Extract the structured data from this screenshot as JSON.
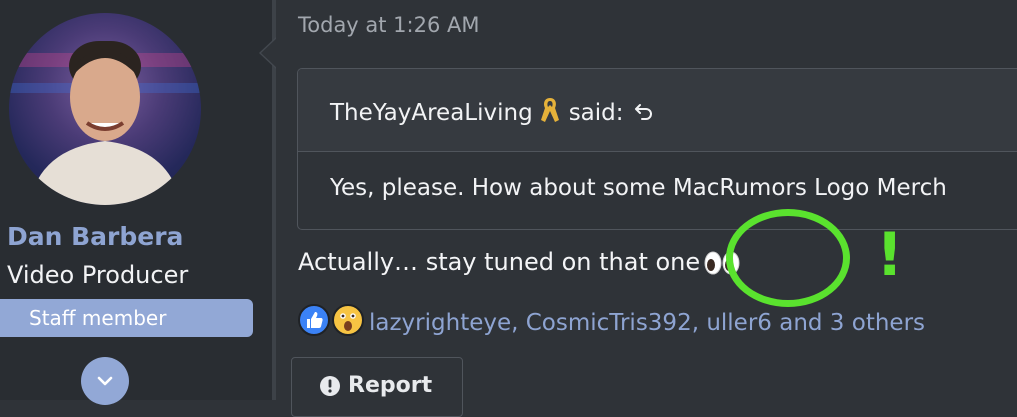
{
  "author": {
    "name": "Dan Barbera",
    "title": "Video Producer",
    "badge": "Staff member"
  },
  "post": {
    "timestamp": "Today at 1:26 AM",
    "quote": {
      "author": "TheYayAreaLiving",
      "said": "said:",
      "body": "Yes, please. How about some MacRumors Logo Merch"
    },
    "message": "Actually… stay tuned on that one"
  },
  "reactions": {
    "names": "lazyrighteye, CosmicTris392, uller6 and 3 others"
  },
  "actions": {
    "report_label": "Report"
  },
  "annotation": {
    "mark": "!",
    "color": "#5ae22e"
  },
  "colors": {
    "background": "#2f3338",
    "sidebar": "#292d32",
    "accent": "#92a8d6",
    "username": "#8ea4d2"
  },
  "icons": [
    "ribbon-icon",
    "goto-icon",
    "eyes-emoji-icon",
    "like-icon",
    "wow-icon",
    "exclamation-circle-icon",
    "chevron-down-icon"
  ]
}
